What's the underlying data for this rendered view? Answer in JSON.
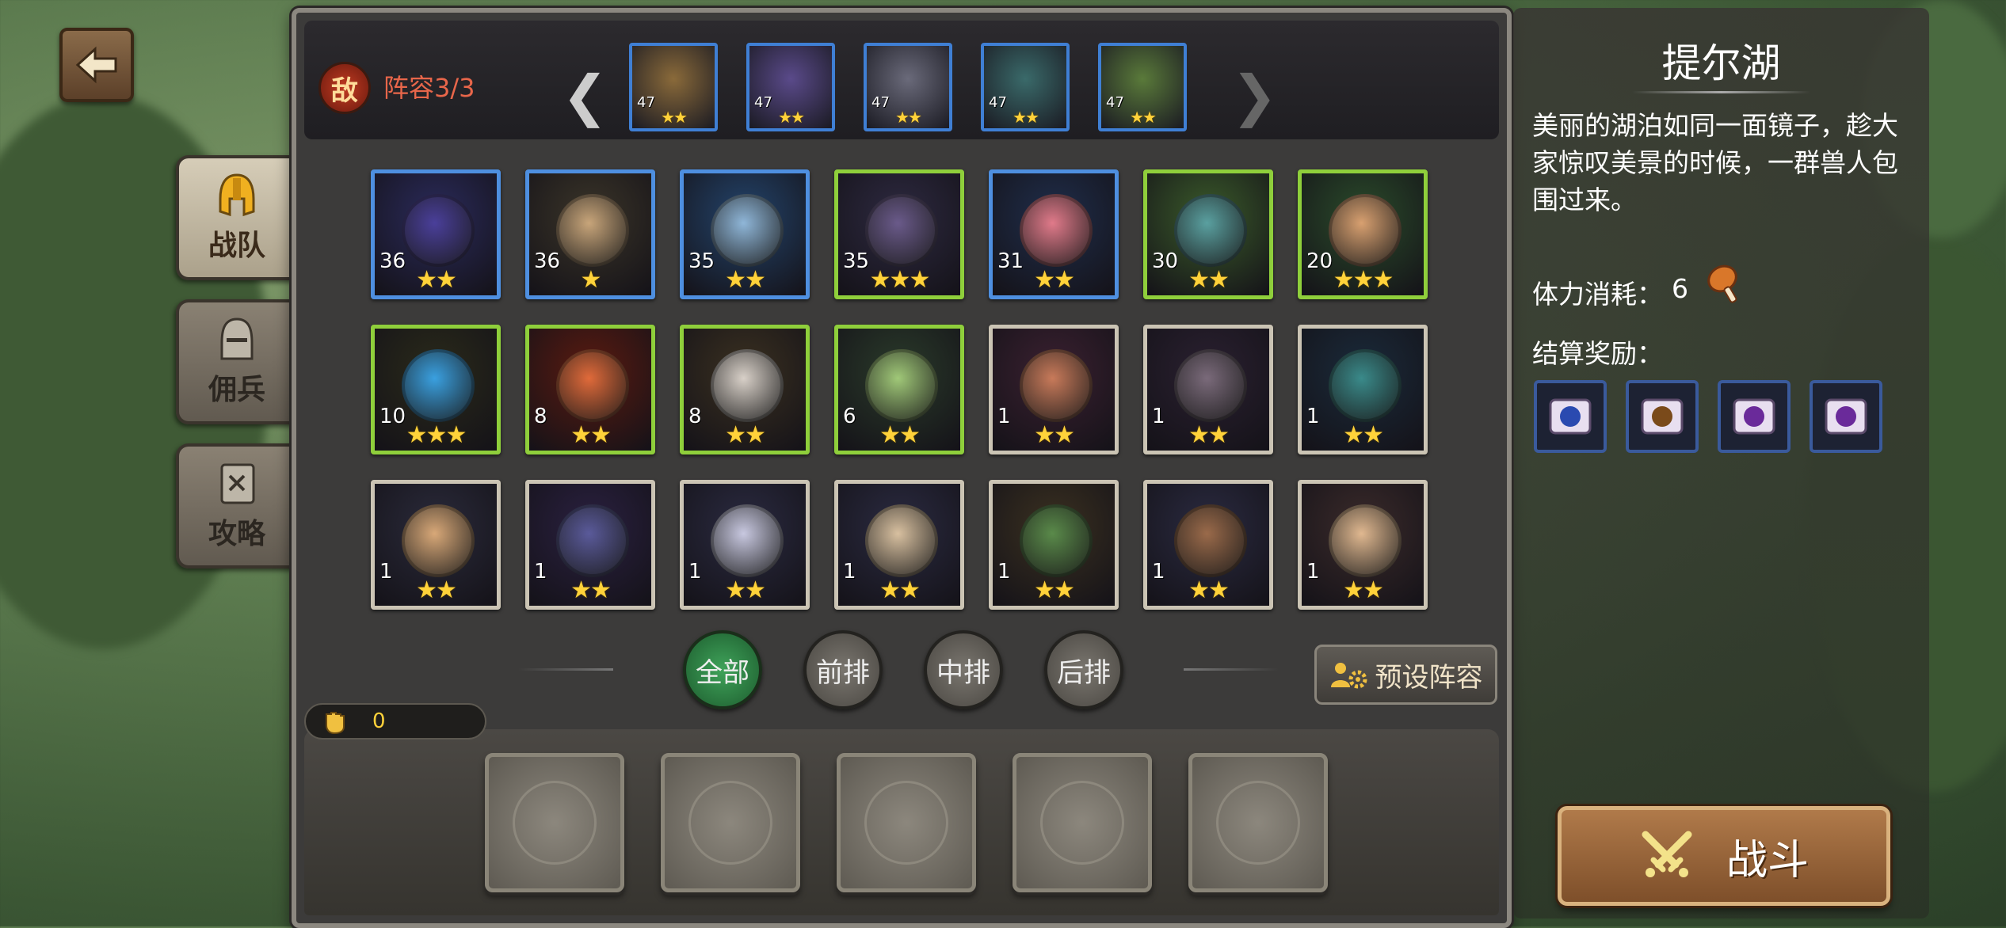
{
  "nav": {
    "back_icon": "arrow-left-icon"
  },
  "side_tabs": [
    {
      "label": "战队",
      "icon": "helmet-icon",
      "active": true
    },
    {
      "label": "佣兵",
      "icon": "knight-helmet-icon",
      "active": false
    },
    {
      "label": "攻略",
      "icon": "guide-book-icon",
      "active": false
    }
  ],
  "enemy": {
    "badge": "敌",
    "lineup_label": "阵容3/3",
    "prev_icon": "chevron-left-icon",
    "next_icon": "chevron-right-icon",
    "units": [
      {
        "level": "47",
        "stars": "★★",
        "color": "#8a6a3a"
      },
      {
        "level": "47",
        "stars": "★★",
        "color": "#5a4a8a"
      },
      {
        "level": "47",
        "stars": "★★",
        "color": "#6a6a7a"
      },
      {
        "level": "47",
        "stars": "★★",
        "color": "#3a6a6a"
      },
      {
        "level": "47",
        "stars": "★★",
        "color": "#5a7a3a"
      }
    ]
  },
  "heroes": [
    {
      "level": "36",
      "stars": "★★",
      "border": "blue",
      "bg": "#2a2a5a",
      "face": "#4a3f9a"
    },
    {
      "level": "36",
      "stars": "★",
      "border": "blue",
      "bg": "#3a3428",
      "face": "#c8a57a"
    },
    {
      "level": "35",
      "stars": "★★",
      "border": "blue",
      "bg": "#23436a",
      "face": "#8fb6d8"
    },
    {
      "level": "35",
      "stars": "★★★",
      "border": "green",
      "bg": "#2d2940",
      "face": "#6a5a8a"
    },
    {
      "level": "31",
      "stars": "★★",
      "border": "blue",
      "bg": "#1f2d4a",
      "face": "#e07a8a"
    },
    {
      "level": "30",
      "stars": "★★",
      "border": "green",
      "bg": "#3a5a2a",
      "face": "#5aa0a0"
    },
    {
      "level": "20",
      "stars": "★★★",
      "border": "green",
      "bg": "#2a4a2a",
      "face": "#d8a070"
    },
    {
      "level": "10",
      "stars": "★★★",
      "border": "green",
      "bg": "#2a2a1a",
      "face": "#3aa0e0"
    },
    {
      "level": "8",
      "stars": "★★",
      "border": "green",
      "bg": "#5a1a10",
      "face": "#e06a3a"
    },
    {
      "level": "8",
      "stars": "★★",
      "border": "green",
      "bg": "#3a3020",
      "face": "#d8d0c8"
    },
    {
      "level": "6",
      "stars": "★★",
      "border": "green",
      "bg": "#2a3a2a",
      "face": "#a0c878"
    },
    {
      "level": "1",
      "stars": "★★",
      "border": "gray",
      "bg": "#3a2030",
      "face": "#c87a5a"
    },
    {
      "level": "1",
      "stars": "★★",
      "border": "gray",
      "bg": "#2a2030",
      "face": "#7a6a7a"
    },
    {
      "level": "1",
      "stars": "★★",
      "border": "gray",
      "bg": "#1a2a3a",
      "face": "#3a8a8a"
    },
    {
      "level": "1",
      "stars": "★★",
      "border": "gray",
      "bg": "#2a2a3a",
      "face": "#d8a878"
    },
    {
      "level": "1",
      "stars": "★★",
      "border": "gray",
      "bg": "#2a2040",
      "face": "#5a5a9a"
    },
    {
      "level": "1",
      "stars": "★★",
      "border": "gray",
      "bg": "#2a2a40",
      "face": "#c8c8e0"
    },
    {
      "level": "1",
      "stars": "★★",
      "border": "gray",
      "bg": "#2a2a40",
      "face": "#d8c0a0"
    },
    {
      "level": "1",
      "stars": "★★",
      "border": "gray",
      "bg": "#3a3020",
      "face": "#5a8a4a"
    },
    {
      "level": "1",
      "stars": "★★",
      "border": "gray",
      "bg": "#2a2a40",
      "face": "#9a6a4a"
    },
    {
      "level": "1",
      "stars": "★★",
      "border": "gray",
      "bg": "#3a2a2a",
      "face": "#e0b890"
    }
  ],
  "filters": {
    "all": "全部",
    "front": "前排",
    "middle": "中排",
    "back": "后排"
  },
  "preset": {
    "label": "预设阵容",
    "icon": "team-gear-icon"
  },
  "power": {
    "icon": "fist-icon",
    "value": "0"
  },
  "stage": {
    "title": "提尔湖",
    "description": "美丽的湖泊如同一面镜子，趁大家惊叹美景的时候，一群兽人包围过来。",
    "stamina_label": "体力消耗：",
    "stamina_value": "6",
    "stamina_icon": "meat-icon",
    "reward_label": "结算奖励：",
    "rewards": [
      {
        "icon": "blue-scroll-icon"
      },
      {
        "icon": "brown-item-icon"
      },
      {
        "icon": "purple-scroll-icon"
      },
      {
        "icon": "purple-scroll-icon"
      }
    ]
  },
  "fight": {
    "label": "战斗",
    "icon": "crossed-swords-icon"
  }
}
